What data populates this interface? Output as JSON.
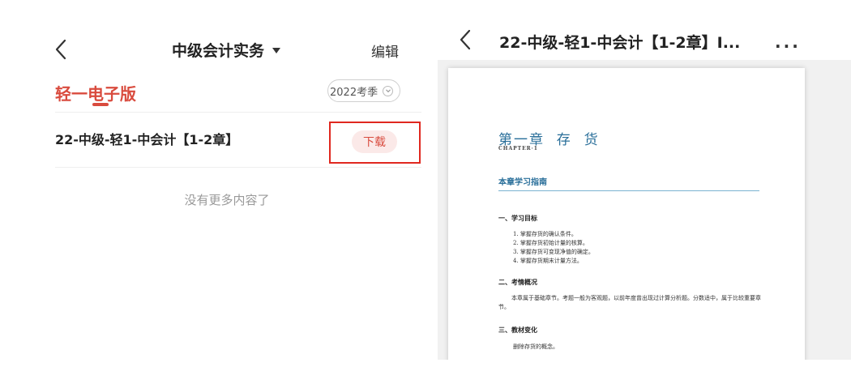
{
  "left": {
    "nav": {
      "back_icon": "chevron-left-icon",
      "title": "中级会计实务",
      "dropdown_icon": "caret-down-icon",
      "edit_label": "编辑"
    },
    "tab_label": "轻一电子版",
    "season_label": "2022考季",
    "book": {
      "title": "22-中级-轻1-中会计【1-2章】",
      "download_label": "下载"
    },
    "empty_text": "没有更多内容了",
    "colors": {
      "accent": "#d94b3e",
      "highlight": "#e0281f"
    }
  },
  "right": {
    "back_icon": "chevron-left-icon",
    "title": "22-中级-轻1-中会计【1-2章】I...",
    "more_label": "...",
    "page": {
      "chapter_title": "第一章  存  货",
      "chapter_sub": "CHAPTER·1",
      "guide_title": "本章学习指南",
      "section1": "一、学习目标",
      "items": [
        "1. 掌握存货的确认条件。",
        "2. 掌握存货初始计量的核算。",
        "3. 掌握存货可变现净值的确定。",
        "4. 掌握存货期末计量方法。"
      ],
      "section2": "二、考情概况",
      "paragraph": "本章属于基础章节。考题一般为客观题，以前年度曾出现过计算分析题。分数适中，属于比较重要章节。",
      "section3": "三、教材变化",
      "change": "删除存货的概念。"
    }
  }
}
